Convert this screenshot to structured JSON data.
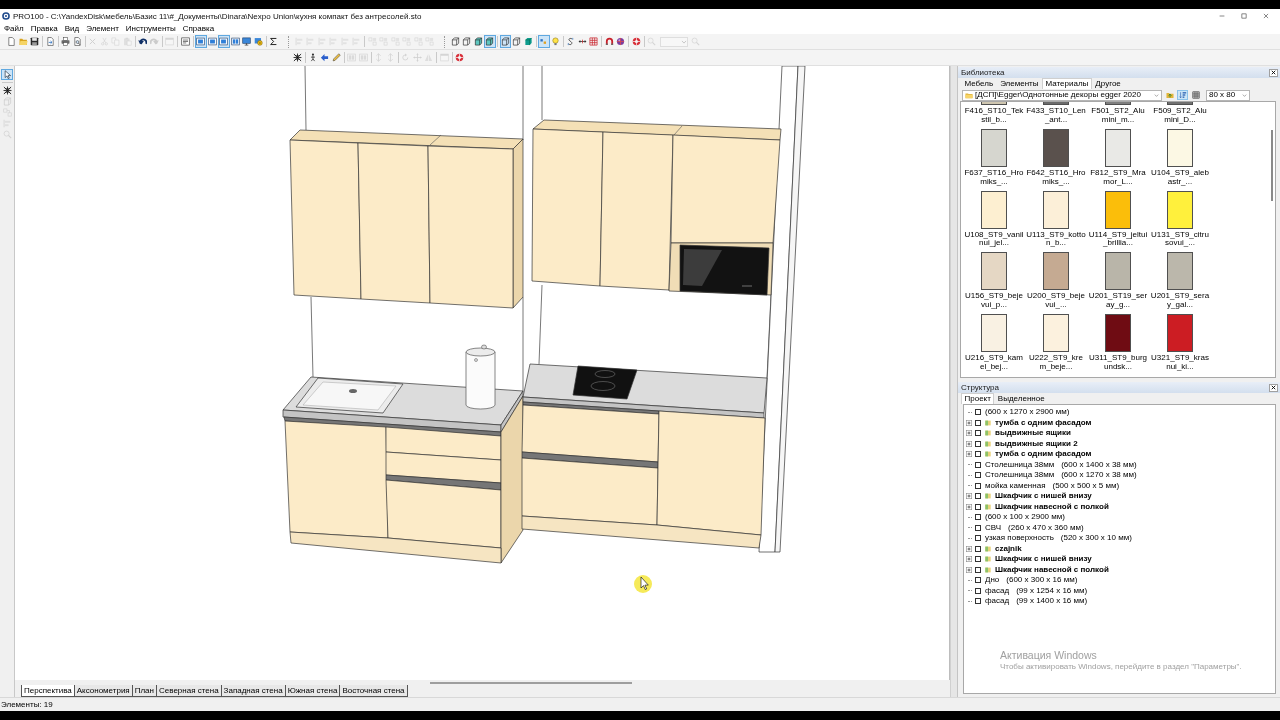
{
  "window": {
    "title": "PRO100 - C:\\YandexDisk\\мебель\\Базис 11\\#_Документы\\Dinara\\Nexpo Union\\кухня компакт без антресолей.sto"
  },
  "menu": [
    "Файл",
    "Правка",
    "Вид",
    "Элемент",
    "Инструменты",
    "Справка"
  ],
  "toolbars": [
    {
      "sections": [
        [
          [
            {
              "kind": "new",
              "on": false,
              "disabled": false
            },
            {
              "kind": "open",
              "on": false,
              "disabled": false
            },
            {
              "kind": "save",
              "on": false,
              "disabled": false
            }
          ],
          [
            {
              "kind": "export",
              "on": false,
              "disabled": false
            }
          ],
          [
            {
              "kind": "print",
              "on": false,
              "disabled": false
            },
            {
              "kind": "preview",
              "on": false,
              "disabled": false
            }
          ],
          [
            {
              "kind": "delete",
              "on": false,
              "disabled": true
            },
            {
              "kind": "cut",
              "on": false,
              "disabled": true
            },
            {
              "kind": "copy",
              "on": false,
              "disabled": true
            },
            {
              "kind": "paste",
              "on": false,
              "disabled": true
            }
          ],
          [
            {
              "kind": "undo",
              "on": false,
              "disabled": false
            },
            {
              "kind": "redo",
              "on": false,
              "disabled": true
            }
          ],
          [
            {
              "kind": "properties",
              "on": false,
              "disabled": true
            }
          ],
          [
            {
              "kind": "panel",
              "on": false,
              "disabled": false
            }
          ],
          [
            {
              "kind": "frame",
              "on": true,
              "disabled": false
            },
            {
              "kind": "frame",
              "on": false,
              "disabled": false
            },
            {
              "kind": "frame",
              "on": true,
              "disabled": false
            },
            {
              "kind": "frames",
              "on": false,
              "disabled": false
            },
            {
              "kind": "screen",
              "on": false,
              "disabled": false
            },
            {
              "kind": "target",
              "on": false,
              "disabled": false
            }
          ],
          [
            {
              "kind": "sum",
              "on": false,
              "disabled": false
            }
          ]
        ],
        [
          [
            {
              "kind": "align",
              "on": false,
              "disabled": true
            },
            {
              "kind": "align",
              "on": false,
              "disabled": true
            },
            {
              "kind": "align",
              "on": false,
              "disabled": true
            },
            {
              "kind": "align",
              "on": false,
              "disabled": true
            },
            {
              "kind": "align",
              "on": false,
              "disabled": true
            },
            {
              "kind": "align",
              "on": false,
              "disabled": true
            }
          ],
          [
            {
              "kind": "spread",
              "on": false,
              "disabled": true
            },
            {
              "kind": "spread",
              "on": false,
              "disabled": true
            },
            {
              "kind": "spread",
              "on": false,
              "disabled": true
            },
            {
              "kind": "spread",
              "on": false,
              "disabled": true
            },
            {
              "kind": "spread",
              "on": false,
              "disabled": true
            },
            {
              "kind": "spread",
              "on": false,
              "disabled": true
            }
          ]
        ],
        [
          [
            {
              "kind": "wire",
              "on": false,
              "disabled": false
            },
            {
              "kind": "wire",
              "on": false,
              "disabled": false
            },
            {
              "kind": "tinted",
              "on": false,
              "disabled": false
            },
            {
              "kind": "tinted",
              "on": true,
              "disabled": false
            }
          ],
          [
            {
              "kind": "wire",
              "on": true,
              "disabled": false
            },
            {
              "kind": "wire",
              "on": false,
              "disabled": false
            },
            {
              "kind": "solid",
              "on": false,
              "disabled": false
            }
          ],
          [
            {
              "kind": "lights",
              "on": true,
              "disabled": false
            },
            {
              "kind": "bulb",
              "on": false,
              "disabled": false
            }
          ],
          [
            {
              "kind": "dimension",
              "on": false,
              "disabled": false
            },
            {
              "kind": "measure",
              "on": false,
              "disabled": false
            },
            {
              "kind": "grid",
              "on": false,
              "disabled": false
            }
          ],
          [
            {
              "kind": "magnet",
              "on": false,
              "disabled": false
            },
            {
              "kind": "sphere",
              "on": false,
              "disabled": false
            }
          ],
          [
            {
              "kind": "render",
              "on": false,
              "disabled": false
            }
          ],
          [
            {
              "kind": "zoom",
              "on": false,
              "disabled": true
            },
            {
              "kind": "field",
              "on": false,
              "disabled": true
            },
            {
              "kind": "zoom",
              "on": false,
              "disabled": true
            }
          ]
        ]
      ]
    },
    {
      "sections": [
        [
          [
            {
              "kind": "pattern",
              "on": false,
              "disabled": false
            }
          ],
          [
            {
              "kind": "move",
              "on": false,
              "disabled": false
            },
            {
              "kind": "rotate",
              "on": false,
              "disabled": false
            },
            {
              "kind": "pencil",
              "on": false,
              "disabled": false
            }
          ],
          [
            {
              "kind": "frames",
              "on": false,
              "disabled": true
            },
            {
              "kind": "frames",
              "on": false,
              "disabled": true
            }
          ],
          [
            {
              "kind": "pin",
              "on": false,
              "disabled": true
            },
            {
              "kind": "pin",
              "on": false,
              "disabled": true
            }
          ],
          [
            {
              "kind": "turn",
              "on": false,
              "disabled": true
            },
            {
              "kind": "plus",
              "on": false,
              "disabled": true
            },
            {
              "kind": "mirror",
              "on": false,
              "disabled": true
            }
          ],
          [
            {
              "kind": "properties",
              "on": false,
              "disabled": true
            }
          ],
          [
            {
              "kind": "render",
              "on": false,
              "disabled": false
            }
          ]
        ]
      ]
    }
  ],
  "side_toolbar": [
    [
      {
        "kind": "pointer",
        "on": true,
        "disabled": false
      }
    ],
    [
      {
        "kind": "pattern",
        "on": false,
        "disabled": false
      },
      {
        "kind": "wire",
        "on": false,
        "disabled": true
      },
      {
        "kind": "linked",
        "on": false,
        "disabled": true
      },
      {
        "kind": "align",
        "on": false,
        "disabled": true
      },
      {
        "kind": "zoom",
        "on": false,
        "disabled": true
      }
    ]
  ],
  "library": {
    "title": "Библиотека",
    "tabs": [
      {
        "label": "Мебель",
        "selected": false
      },
      {
        "label": "Элементы",
        "selected": false
      },
      {
        "label": "Материалы",
        "selected": true
      },
      {
        "label": "Другое",
        "selected": false
      }
    ],
    "folder": "[ДСП]\\Egger\\Однотонные декоры egger 2020",
    "tools": [
      {
        "kind": "up",
        "on": false
      },
      {
        "kind": "sort",
        "on": true
      },
      {
        "kind": "tiles",
        "on": false
      }
    ],
    "thumb_size": "80 x 80",
    "materials": [
      {
        "label": "F416_ST10_Tekstil_b...",
        "color": "#cfc6b0"
      },
      {
        "label": "F433_ST10_Len_ant...",
        "color": "#6b6b6b"
      },
      {
        "label": "F501_ST2_Alumini_m...",
        "color": "#7e7e7e"
      },
      {
        "label": "F509_ST2_Alumini_D...",
        "color": "#707070"
      },
      {
        "label": "F637_ST16_Hromiks_...",
        "color": "#d6d6cf"
      },
      {
        "label": "F642_ST16_Hromiks_...",
        "color": "#5a514d"
      },
      {
        "label": "F812_ST9_Mramor_L...",
        "color": "#e9e9e6"
      },
      {
        "label": "U104_ST9_alebastr_...",
        "color": "#fcf8e4"
      },
      {
        "label": "U108_ST9_vanilnui_jel...",
        "color": "#fdefd1"
      },
      {
        "label": "U113_ST9_kotton_b...",
        "color": "#fcefd8"
      },
      {
        "label": "U114_ST9_jeltui_brillia...",
        "color": "#fbbe0a"
      },
      {
        "label": "U131_ST9_citrusovui_...",
        "color": "#fff03c"
      },
      {
        "label": "U156_ST9_bejevui_p...",
        "color": "#e5d7c4"
      },
      {
        "label": "U200_ST9_bejevui_...",
        "color": "#c5aa92"
      },
      {
        "label": "U201_ST19_seray_g...",
        "color": "#b9b5a9"
      },
      {
        "label": "U201_ST9_seray_gal...",
        "color": "#bbb7ab"
      },
      {
        "label": "U216_ST9_kamel_bej...",
        "color": "#f9f1e3"
      },
      {
        "label": "U222_ST9_krem_beje...",
        "color": "#fcf1de"
      },
      {
        "label": "U311_ST9_burgundsk...",
        "color": "#6f0c13"
      },
      {
        "label": "U321_ST9_krasnui_ki...",
        "color": "#cc1d23"
      }
    ]
  },
  "structure": {
    "title": "Структура",
    "tabs": [
      {
        "label": "Проект",
        "selected": true
      },
      {
        "label": "Выделенное",
        "selected": false
      }
    ],
    "items": [
      {
        "kind": "part",
        "size": "(600 x 1270 x 2900 мм)",
        "checked": false
      },
      {
        "kind": "group",
        "name": "тумба с одним фасадом",
        "expanded": false,
        "checked": false
      },
      {
        "kind": "group",
        "name": "выдвижные ящики",
        "expanded": false,
        "checked": false
      },
      {
        "kind": "group",
        "name": "выдвижные ящики 2",
        "expanded": false,
        "checked": false
      },
      {
        "kind": "group",
        "name": "тумба с одним фасадом",
        "expanded": false,
        "checked": false
      },
      {
        "kind": "part",
        "name": "Столешница 38мм",
        "size": "(600 x 1400 x 38 мм)",
        "checked": false
      },
      {
        "kind": "part",
        "name": "Столешница 38мм",
        "size": "(600 x 1270 x 38 мм)",
        "checked": false
      },
      {
        "kind": "part",
        "name": "мойка каменная",
        "size": "(500 x 500 x 5 мм)",
        "checked": false
      },
      {
        "kind": "group",
        "name": "Шкафчик с нишей внизу",
        "expanded": false,
        "checked": false
      },
      {
        "kind": "group",
        "name": "Шкафчик навесной с полкой",
        "expanded": false,
        "checked": false
      },
      {
        "kind": "part",
        "size": "(600 x 100 x 2900 мм)",
        "checked": false
      },
      {
        "kind": "part",
        "name": "СВЧ",
        "size": "(260 x 470 x 360 мм)",
        "checked": false
      },
      {
        "kind": "part",
        "name": "узкая поверхность",
        "size": "(520 x 300 x 10 мм)",
        "checked": false
      },
      {
        "kind": "group",
        "name": "czajnik",
        "expanded": false,
        "checked": false
      },
      {
        "kind": "group",
        "name": "Шкафчик с нишей внизу",
        "expanded": false,
        "checked": false
      },
      {
        "kind": "group",
        "name": "Шкафчик навесной с полкой",
        "expanded": false,
        "checked": false
      },
      {
        "kind": "part",
        "name": "Дно",
        "size": "(600 x 300 x 16 мм)",
        "checked": false
      },
      {
        "kind": "part",
        "name": "фасад",
        "size": "(99 x 1254 x 16 мм)",
        "checked": false
      },
      {
        "kind": "part",
        "name": "фасад",
        "size": "(99 x 1400 x 16 мм)",
        "checked": false
      }
    ]
  },
  "view_tabs": [
    {
      "label": "Перспектива",
      "selected": true
    },
    {
      "label": "Аксонометрия",
      "selected": false
    },
    {
      "label": "План",
      "selected": false
    },
    {
      "label": "Северная стена",
      "selected": false
    },
    {
      "label": "Западная стена",
      "selected": false
    },
    {
      "label": "Южная стена",
      "selected": false
    },
    {
      "label": "Восточная стена",
      "selected": false
    }
  ],
  "status_bar": {
    "text": "Элементы: 19"
  },
  "os_notice": {
    "title": "Активация Windows",
    "text": "Чтобы активировать Windows, перейдите в раздел \"Параметры\"."
  }
}
